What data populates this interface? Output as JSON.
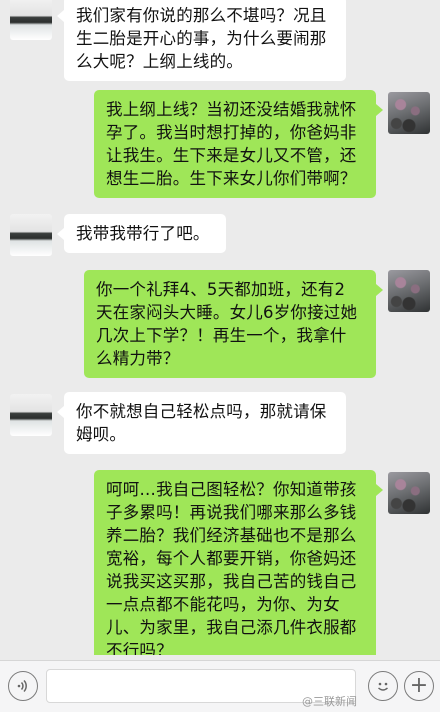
{
  "messages": [
    {
      "side": "in",
      "lines": [
        "我们家有你说的那么不堪吗？况且",
        "生二胎是开心的事，为什么要闹那",
        "么大呢？上纲上线的。"
      ]
    },
    {
      "side": "out",
      "lines": [
        "我上纲上线？当初还没结婚我就怀",
        "孕了。我当时想打掉的，你爸妈非",
        "让我生。生下来是女儿又不管，还",
        "想生二胎。生下来女儿你们带啊？"
      ]
    },
    {
      "side": "in",
      "lines": [
        "我带我带行了吧。"
      ]
    },
    {
      "side": "out",
      "lines": [
        "你一个礼拜4、5天都加班，还有2",
        "天在家闷头大睡。女儿6岁你接过她",
        "几次上下学？！再生一个，我拿什",
        "么精力带？"
      ]
    },
    {
      "side": "in",
      "lines": [
        "你不就想自己轻松点吗，那就请保",
        "姆呗。"
      ]
    },
    {
      "side": "out",
      "lines": [
        "呵呵…我自己图轻松？你知道带孩",
        "子多累吗！再说我们哪来那么多钱",
        "养二胎？我们经济基础也不是那么",
        "宽裕，每个人都要开销，你爸妈还",
        "说我买这买那，我自己苦的钱自己",
        "一点点都不能花吗，为你、为女",
        "儿、为家里，我自己添几件衣服都",
        "不行吗？"
      ]
    }
  ],
  "input_bar": {
    "voice_icon": "voice-icon",
    "emoji_icon": "emoji-icon",
    "plus_icon": "plus-icon",
    "plus_glyph": "+",
    "text_value": ""
  },
  "watermark": "@三联新闻"
}
